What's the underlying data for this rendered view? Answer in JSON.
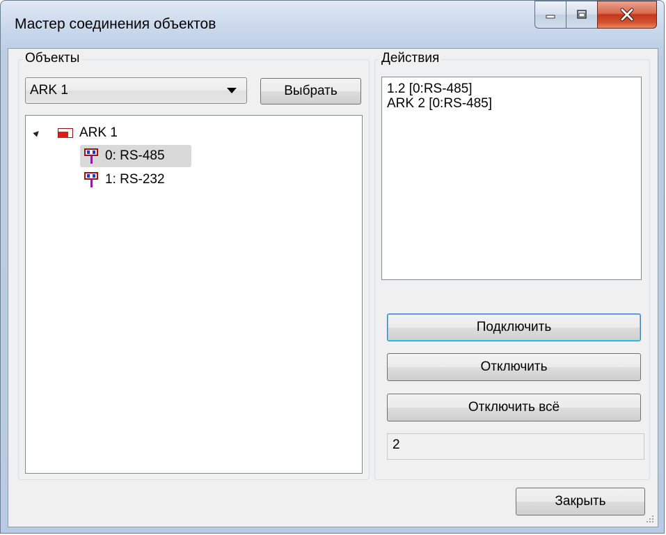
{
  "window": {
    "title": "Мастер соединения объектов"
  },
  "objects_group": {
    "label": "Объекты",
    "combo_value": "ARK 1",
    "select_button": "Выбрать",
    "tree": {
      "root": "ARK 1",
      "children": [
        "0: RS-485",
        "1: RS-232"
      ]
    }
  },
  "actions_group": {
    "label": "Действия",
    "items": [
      "1.2 [0:RS-485]",
      "ARK 2 [0:RS-485]"
    ],
    "connect_button": "Подключить",
    "disconnect_button": "Отключить",
    "disconnect_all_button": "Отключить всё",
    "counter_value": "2"
  },
  "footer": {
    "close_button": "Закрыть"
  },
  "icons": {
    "minimize": "minimize-icon",
    "maximize": "maximize-icon",
    "close": "close-icon",
    "object": "device-icon",
    "port": "port-icon"
  },
  "colors": {
    "close_button": "#c2381a",
    "selection": "#d9d9d9",
    "default_button_border": "#3c7fb1"
  }
}
